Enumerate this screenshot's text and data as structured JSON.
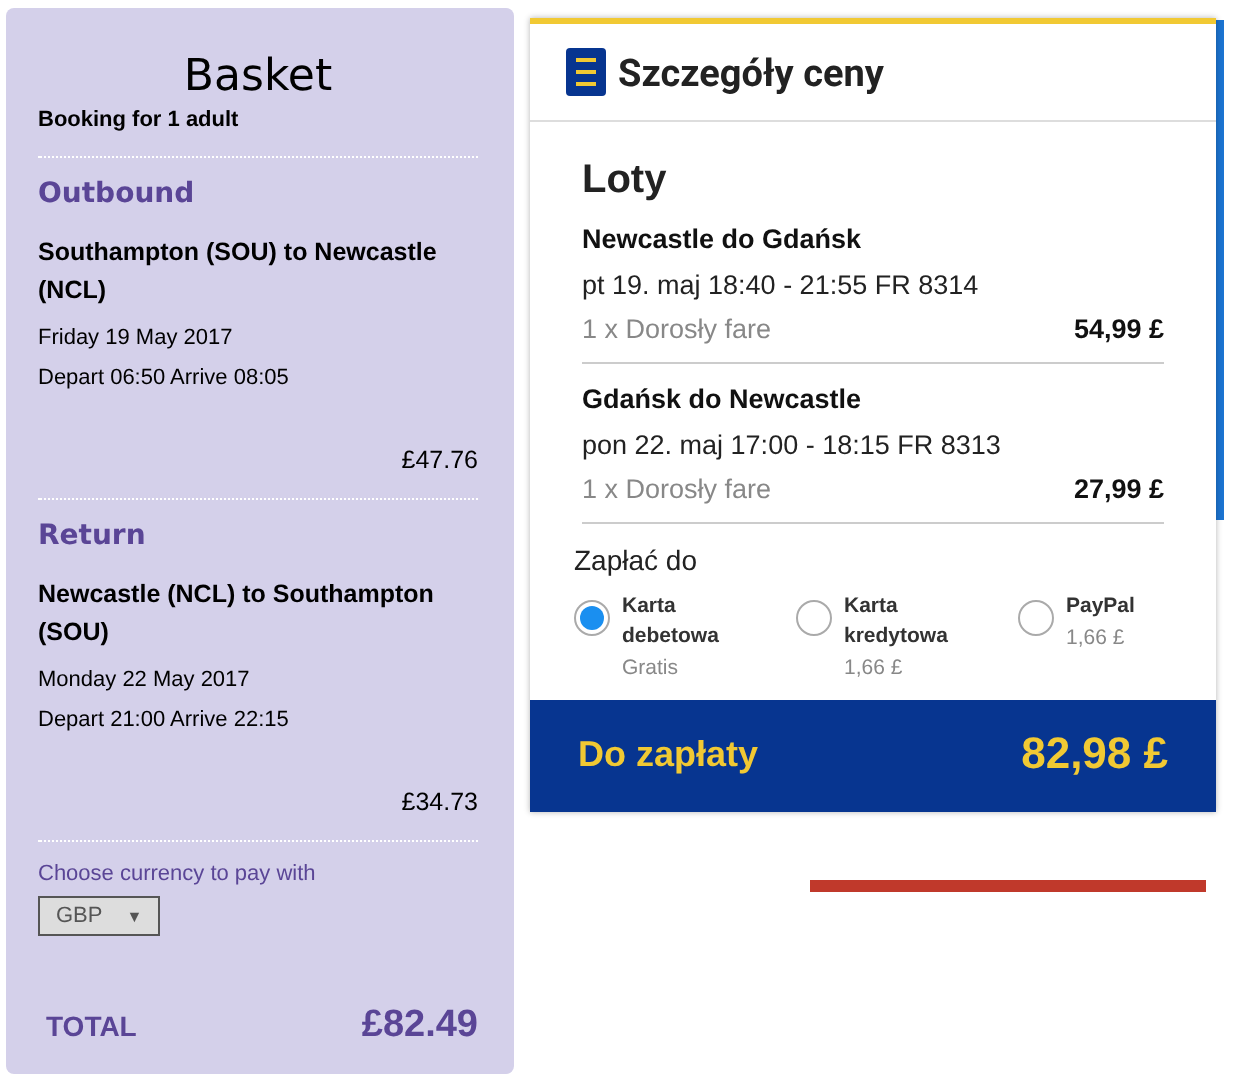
{
  "basket": {
    "title": "Basket",
    "subtitle": "Booking for 1 adult",
    "legs": [
      {
        "heading": "Outbound",
        "route": "Southampton (SOU) to Newcastle (NCL)",
        "date": "Friday 19 May 2017",
        "times": "Depart 06:50 Arrive 08:05",
        "price": "£47.76"
      },
      {
        "heading": "Return",
        "route": "Newcastle (NCL) to Southampton (SOU)",
        "date": "Monday 22 May 2017",
        "times": "Depart 21:00 Arrive 22:15",
        "price": "£34.73"
      }
    ],
    "currency_label": "Choose currency to pay with",
    "currency": {
      "value": "GBP",
      "arrow": "▼",
      "disabled": true
    },
    "total_label": "TOTAL",
    "total": "£82.49"
  },
  "price_details": {
    "title": "Szczegóły ceny",
    "section": "Loty",
    "flights": [
      {
        "route": "Newcastle do Gdańsk",
        "schedule": "pt 19. maj 18:40 - 21:55 FR 8314",
        "fare": "1 x Dorosły fare",
        "price": "54,99 £"
      },
      {
        "route": "Gdańsk do Newcastle",
        "schedule": "pon 22. maj 17:00 - 18:15 FR 8313",
        "fare": "1 x Dorosły fare",
        "price": "27,99 £"
      }
    ],
    "pay_label": "Zapłać do",
    "payment_options": [
      {
        "label": "Karta debetowa",
        "fee": "Gratis",
        "selected": true
      },
      {
        "label": "Karta kredytowa",
        "fee": "1,66 £",
        "selected": false
      },
      {
        "label": "PayPal",
        "fee": "1,66 £",
        "selected": false
      }
    ],
    "total_label": "Do zapłaty",
    "total": "82,98 £"
  }
}
